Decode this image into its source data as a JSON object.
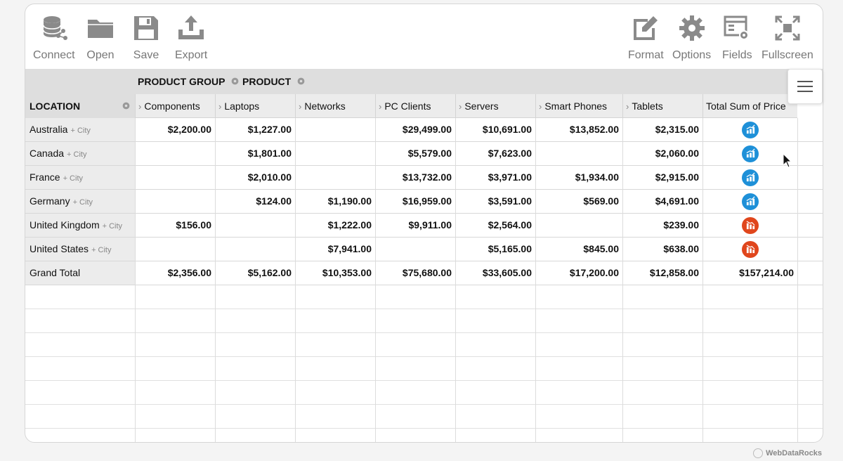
{
  "toolbar": {
    "left": [
      {
        "label": "Connect",
        "icon": "database-connect-icon"
      },
      {
        "label": "Open",
        "icon": "folder-icon"
      },
      {
        "label": "Save",
        "icon": "floppy-disk-icon"
      },
      {
        "label": "Export",
        "icon": "export-tray-icon"
      }
    ],
    "right": [
      {
        "label": "Format",
        "icon": "format-pencil-icon"
      },
      {
        "label": "Options",
        "icon": "gear-icon"
      },
      {
        "label": "Fields",
        "icon": "fields-icon"
      },
      {
        "label": "Fullscreen",
        "icon": "fullscreen-icon"
      }
    ]
  },
  "pivot": {
    "column_fields": [
      "PRODUCT GROUP",
      "PRODUCT"
    ],
    "row_field": "LOCATION",
    "columns": [
      "Components",
      "Laptops",
      "Networks",
      "PC Clients",
      "Servers",
      "Smart Phones",
      "Tablets",
      "Total Sum of Price"
    ],
    "rows": [
      {
        "label": "Australia",
        "expand": "+ City",
        "values": [
          "$2,200.00",
          "$1,227.00",
          "",
          "$29,499.00",
          "$10,691.00",
          "$13,852.00",
          "$2,315.00"
        ],
        "total_icon": "bar-chart-up-icon"
      },
      {
        "label": "Canada",
        "expand": "+ City",
        "values": [
          "",
          "$1,801.00",
          "",
          "$5,579.00",
          "$7,623.00",
          "",
          "$2,060.00"
        ],
        "total_icon": "bar-chart-up-icon"
      },
      {
        "label": "France",
        "expand": "+ City",
        "values": [
          "",
          "$2,010.00",
          "",
          "$13,732.00",
          "$3,971.00",
          "$1,934.00",
          "$2,915.00"
        ],
        "total_icon": "bar-chart-up-icon"
      },
      {
        "label": "Germany",
        "expand": "+ City",
        "values": [
          "",
          "$124.00",
          "$1,190.00",
          "$16,959.00",
          "$3,591.00",
          "$569.00",
          "$4,691.00"
        ],
        "total_icon": "bar-chart-up-icon"
      },
      {
        "label": "United Kingdom",
        "expand": "+ City",
        "values": [
          "$156.00",
          "",
          "$1,222.00",
          "$9,911.00",
          "$2,564.00",
          "",
          "$239.00"
        ],
        "total_icon": "bar-chart-down-icon"
      },
      {
        "label": "United States",
        "expand": "+ City",
        "values": [
          "",
          "",
          "$7,941.00",
          "",
          "$5,165.00",
          "$845.00",
          "$638.00"
        ],
        "total_icon": "bar-chart-down-icon"
      }
    ],
    "grand_total": {
      "label": "Grand Total",
      "values": [
        "$2,356.00",
        "$5,162.00",
        "$10,353.00",
        "$75,680.00",
        "$33,605.00",
        "$17,200.00",
        "$12,858.00",
        "$157,214.00"
      ]
    }
  },
  "brand": "WebDataRocks",
  "colors": {
    "up_icon": "#1e90d8",
    "down_icon": "#e0461c",
    "header_bg": "#dedede"
  }
}
